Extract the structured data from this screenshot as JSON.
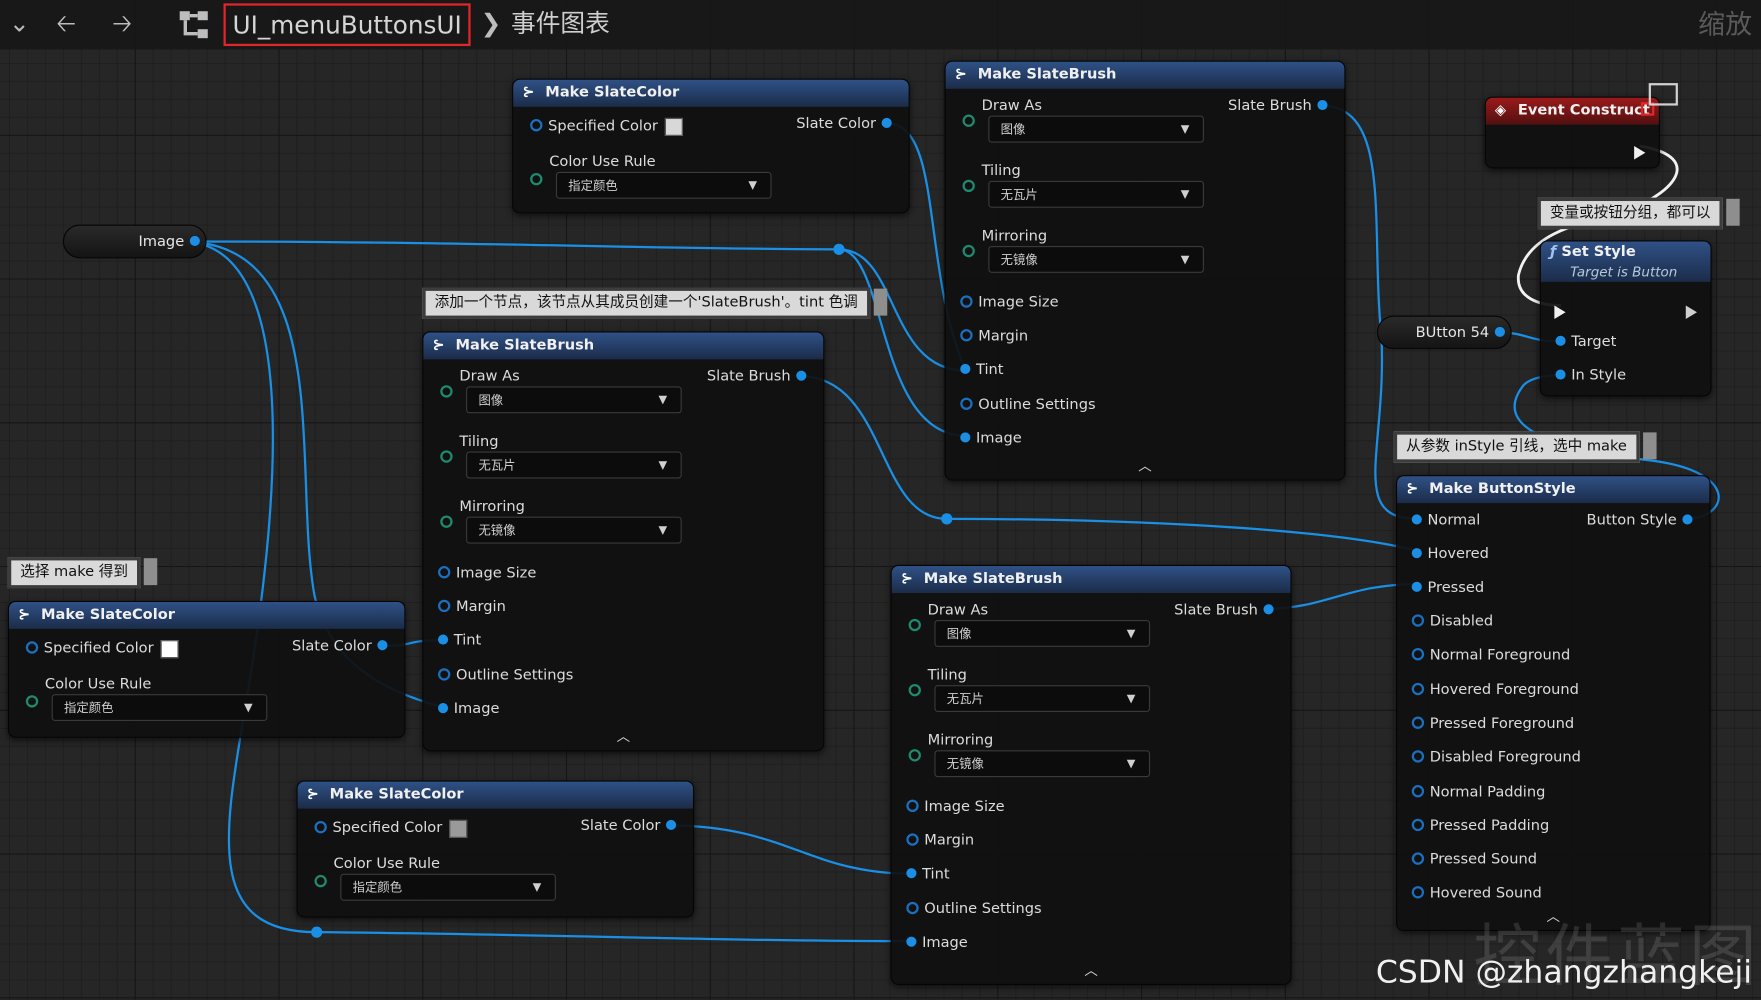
{
  "toolbar": {
    "menu_glyph": "⌄",
    "back_glyph": "🡠",
    "forward_glyph": "🡢",
    "hierarchy_icon": "hierarchy-icon",
    "breadcrumb_blueprint": "UI_menuButtonsUI",
    "separator": "❯",
    "breadcrumb_graph": "事件图表",
    "zoom_label": "缩放"
  },
  "colors": {
    "accent_highlight": "#e3262a",
    "pin_blue": "#1b8fe6",
    "node_header_blue": "#2f5186",
    "event_header_red": "#9a1a1a"
  },
  "comments": {
    "c1": "添加一个节点，该节点从其成员创建一个'SlateBrush'。tint 色调",
    "c2": "选择 make 得到",
    "c3": "变量或按钮分组，都可以",
    "c4": "从参数 inStyle 引线，选中 make"
  },
  "variables": {
    "image": "Image",
    "button54": "BUtton 54"
  },
  "slate_color_nodes": [
    {
      "title": "Make SlateColor",
      "specified_color": "Specified Color",
      "swatch": "#d8d8d8",
      "color_use_rule": "Color Use Rule",
      "rule_value": "指定颜色",
      "output": "Slate Color"
    },
    {
      "title": "Make SlateColor",
      "specified_color": "Specified Color",
      "swatch": "#ffffff",
      "color_use_rule": "Color Use Rule",
      "rule_value": "指定颜色",
      "output": "Slate Color"
    },
    {
      "title": "Make SlateColor",
      "specified_color": "Specified Color",
      "swatch": "#9a9a9a",
      "color_use_rule": "Color Use Rule",
      "rule_value": "指定颜色",
      "output": "Slate Color"
    }
  ],
  "slate_brush_nodes": [
    {
      "title": "Make SlateBrush",
      "draw_as": "Draw As",
      "draw_as_value": "图像",
      "tiling": "Tiling",
      "tiling_value": "无瓦片",
      "mirroring": "Mirroring",
      "mirroring_value": "无镜像",
      "image_size": "Image Size",
      "margin": "Margin",
      "tint": "Tint",
      "outline": "Outline Settings",
      "image": "Image",
      "output": "Slate Brush"
    },
    {
      "title": "Make SlateBrush",
      "draw_as": "Draw As",
      "draw_as_value": "图像",
      "tiling": "Tiling",
      "tiling_value": "无瓦片",
      "mirroring": "Mirroring",
      "mirroring_value": "无镜像",
      "image_size": "Image Size",
      "margin": "Margin",
      "tint": "Tint",
      "outline": "Outline Settings",
      "image": "Image",
      "output": "Slate Brush"
    },
    {
      "title": "Make SlateBrush",
      "draw_as": "Draw As",
      "draw_as_value": "图像",
      "tiling": "Tiling",
      "tiling_value": "无瓦片",
      "mirroring": "Mirroring",
      "mirroring_value": "无镜像",
      "image_size": "Image Size",
      "margin": "Margin",
      "tint": "Tint",
      "outline": "Outline Settings",
      "image": "Image",
      "output": "Slate Brush"
    }
  ],
  "event_construct": {
    "title": "Event Construct"
  },
  "set_style": {
    "title": "Set Style",
    "subtitle": "Target is Button",
    "target": "Target",
    "in_style": "In Style"
  },
  "button_style": {
    "title": "Make ButtonStyle",
    "output": "Button Style",
    "pins": [
      "Normal",
      "Hovered",
      "Pressed",
      "Disabled",
      "Normal Foreground",
      "Hovered Foreground",
      "Pressed Foreground",
      "Disabled Foreground",
      "Normal Padding",
      "Pressed Padding",
      "Pressed Sound",
      "Hovered Sound"
    ]
  },
  "watermark": {
    "text": "CSDN @zhangzhangkeji",
    "bg_text": "控件蓝图"
  }
}
